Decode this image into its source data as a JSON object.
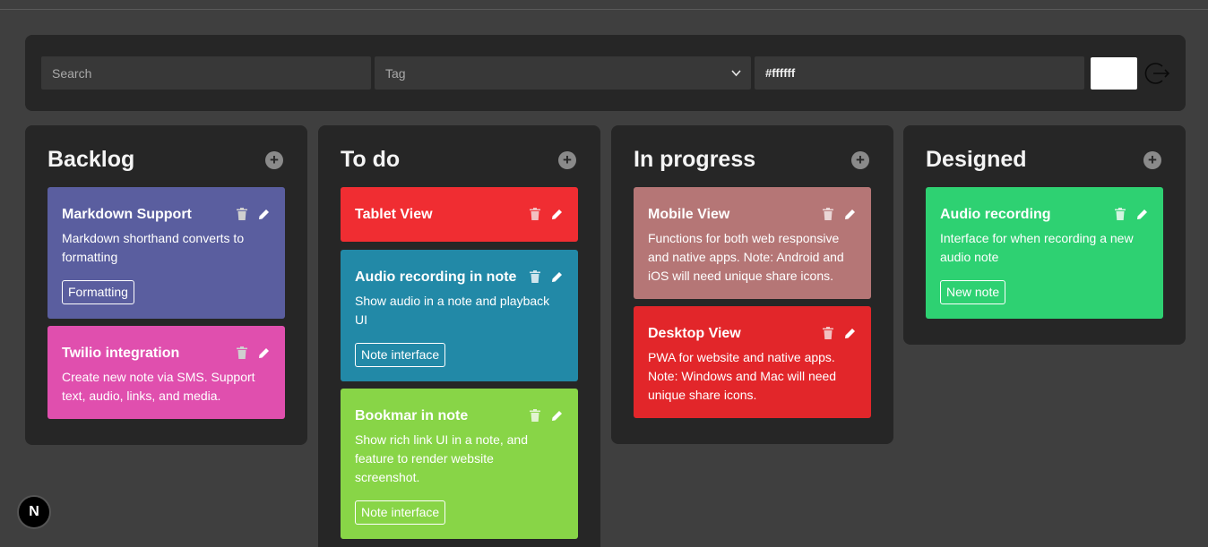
{
  "toolbar": {
    "search_placeholder": "Search",
    "tag_placeholder": "Tag",
    "color_value": "#ffffff",
    "swatch_color": "#ffffff",
    "logout_icon": "logout-icon"
  },
  "columns": [
    {
      "title": "Backlog",
      "cards": [
        {
          "title": "Markdown Support",
          "desc": "Markdown shorthand converts to formatting",
          "tag": "Formatting",
          "color": "#5a5e9f"
        },
        {
          "title": "Twilio integration",
          "desc": "Create new note via SMS. Support text, audio, links, and media.",
          "tag": "",
          "color": "#e04fae"
        }
      ]
    },
    {
      "title": "To do",
      "cards": [
        {
          "title": "Tablet View",
          "desc": "",
          "tag": "",
          "color": "#f02d32"
        },
        {
          "title": "Audio recording in note",
          "desc": "Show audio in a note and playback UI",
          "tag": "Note interface",
          "color": "#2289a7"
        },
        {
          "title": "Bookmar in note",
          "desc": "Show rich link UI in a note, and feature to render website screenshot.",
          "tag": "Note interface",
          "color": "#88d547"
        }
      ]
    },
    {
      "title": "In progress",
      "cards": [
        {
          "title": "Mobile View",
          "desc": "Functions for both web responsive and native apps. Note: Android and iOS will need unique share icons.",
          "tag": "",
          "color": "#b57676"
        },
        {
          "title": "Desktop View",
          "desc": "PWA for website and native apps. Note: Windows and Mac will need unique share icons.",
          "tag": "",
          "color": "#e2262a"
        }
      ]
    },
    {
      "title": "Designed",
      "cards": [
        {
          "title": "Audio recording",
          "desc": "Interface for when recording a new audio note",
          "tag": "New note",
          "color": "#2ed172"
        }
      ]
    }
  ],
  "badge": {
    "letter": "N"
  }
}
